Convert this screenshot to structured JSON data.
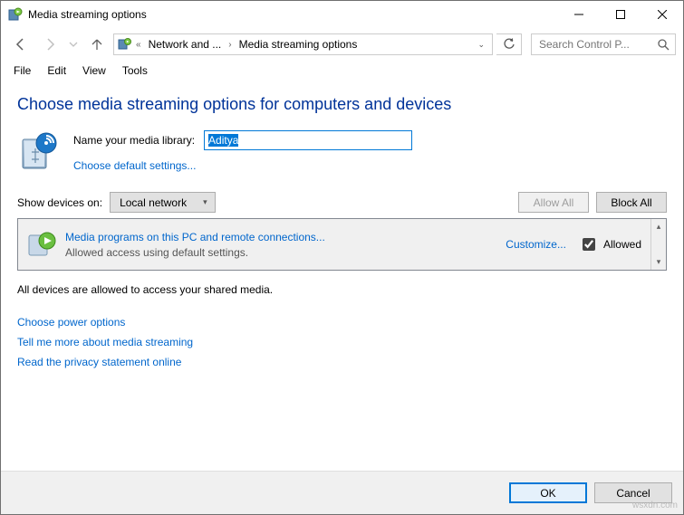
{
  "window_title": "Media streaming options",
  "breadcrumb": {
    "segment1": "Network and ...",
    "segment2": "Media streaming options"
  },
  "search_placeholder": "Search Control P...",
  "menu": {
    "file": "File",
    "edit": "Edit",
    "view": "View",
    "tools": "Tools"
  },
  "heading": "Choose media streaming options for computers and devices",
  "library_label": "Name your media library:",
  "library_value": "Aditya",
  "choose_defaults": "Choose default settings...",
  "show_devices_label": "Show devices on:",
  "show_devices_value": "Local network",
  "allow_all": "Allow All",
  "block_all": "Block All",
  "device": {
    "title": "Media programs on this PC and remote connections...",
    "description": "Allowed access using default settings.",
    "customize": "Customize...",
    "allowed_label": "Allowed"
  },
  "status_line": "All devices are allowed to access your shared media.",
  "links": {
    "power": "Choose power options",
    "more": "Tell me more about media streaming",
    "privacy": "Read the privacy statement online"
  },
  "footer": {
    "ok": "OK",
    "cancel": "Cancel"
  },
  "watermark": "wsxdn.com"
}
